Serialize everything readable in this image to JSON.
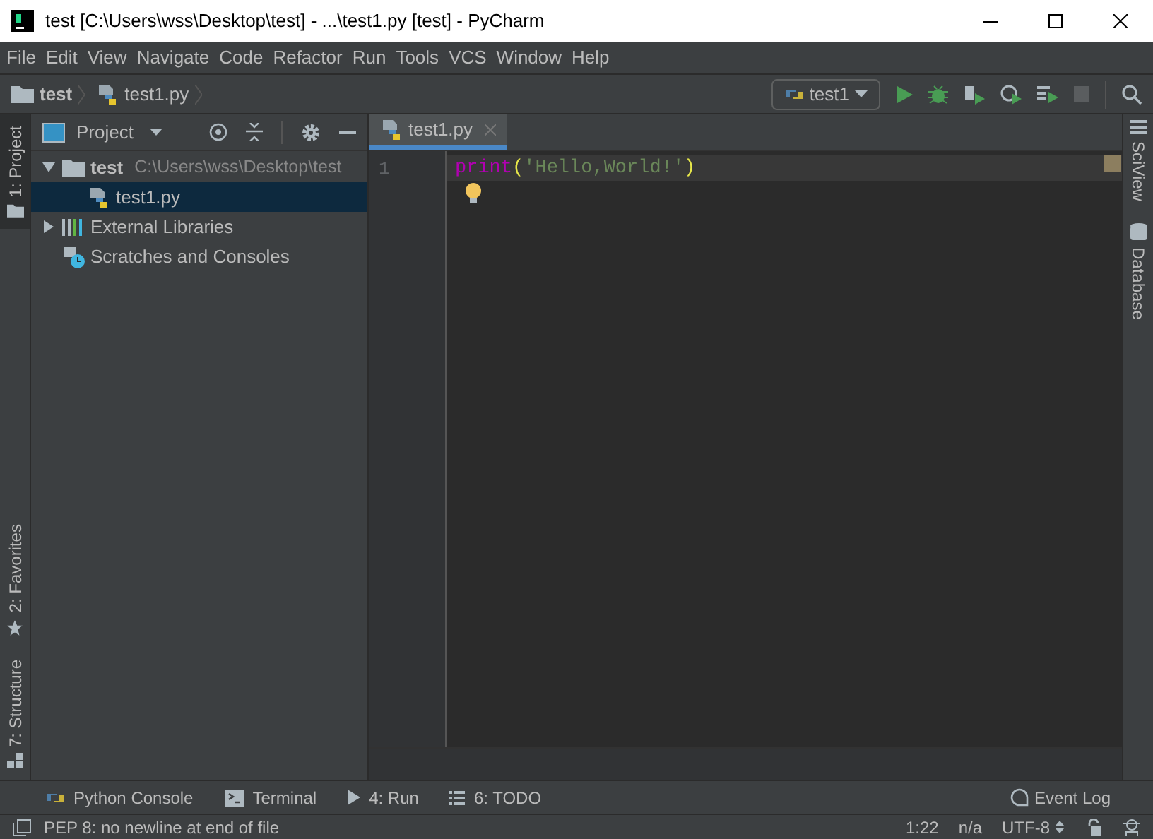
{
  "window": {
    "title": "test [C:\\Users\\wss\\Desktop\\test] - ...\\test1.py [test] - PyCharm"
  },
  "menu": [
    "File",
    "Edit",
    "View",
    "Navigate",
    "Code",
    "Refactor",
    "Run",
    "Tools",
    "VCS",
    "Window",
    "Help"
  ],
  "breadcrumb": [
    {
      "label": "test",
      "kind": "folder"
    },
    {
      "label": "test1.py",
      "kind": "python"
    }
  ],
  "run_config": "test1",
  "left_tools": [
    {
      "label": "1: Project",
      "selected": true,
      "kind": "folder"
    },
    {
      "label": "2: Favorites",
      "selected": false,
      "kind": "star"
    },
    {
      "label": "7: Structure",
      "selected": false,
      "kind": "structure"
    }
  ],
  "project_panel": {
    "title": "Project",
    "tree": [
      {
        "label": "test",
        "path": "C:\\Users\\wss\\Desktop\\test",
        "kind": "folder",
        "expanded": true,
        "selected": false,
        "children": [
          {
            "label": "test1.py",
            "kind": "python",
            "selected": true
          }
        ]
      },
      {
        "label": "External Libraries",
        "kind": "library",
        "expanded": false,
        "selected": false
      },
      {
        "label": "Scratches and Consoles",
        "kind": "scratch",
        "selected": false
      }
    ]
  },
  "tabs": [
    {
      "label": "test1.py",
      "selected": true
    }
  ],
  "editor": {
    "lines": [
      {
        "number": "1",
        "current": true,
        "tokens": [
          {
            "kind": "keyword",
            "text": "print"
          },
          {
            "kind": "paren",
            "text": "("
          },
          {
            "kind": "string",
            "text": "'Hello,World!'"
          },
          {
            "kind": "paren",
            "text": ")"
          }
        ]
      }
    ]
  },
  "right_tools": [
    {
      "label": "SciView",
      "kind": "grid"
    },
    {
      "label": "Database",
      "kind": "database"
    }
  ],
  "bottom_tools": [
    {
      "label": "Python Console",
      "kind": "python"
    },
    {
      "label": "Terminal",
      "kind": "terminal"
    },
    {
      "label": "4: Run",
      "kind": "run"
    },
    {
      "label": "6: TODO",
      "kind": "list"
    }
  ],
  "event_log": "Event Log",
  "status_bar": {
    "message": "PEP 8: no newline at end of file",
    "items": [
      "1:22",
      "n/a",
      "UTF-8"
    ]
  }
}
